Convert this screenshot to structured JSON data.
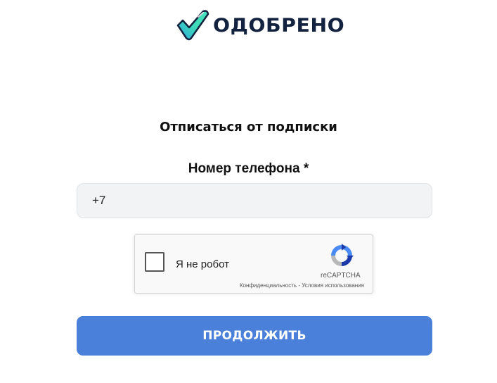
{
  "header": {
    "logo_icon": "checkmark-icon",
    "logo_text": "ОДОБРЕНО"
  },
  "form": {
    "title": "Отписаться от подписки",
    "phone": {
      "label": "Номер телефона *",
      "value": "+7"
    },
    "recaptcha": {
      "checkbox_label": "Я не робот",
      "brand": "reCAPTCHA",
      "privacy_link": "Конфиденциальность",
      "separator": " - ",
      "terms_link": "Условия использования"
    },
    "submit_label": "ПРОДОЛЖИТЬ"
  },
  "colors": {
    "logo_text": "#13223f",
    "logo_check_start": "#3dd9b8",
    "logo_check_end": "#2d8fd6",
    "button": "#4a7fda",
    "input_bg": "#f1f3f4"
  }
}
